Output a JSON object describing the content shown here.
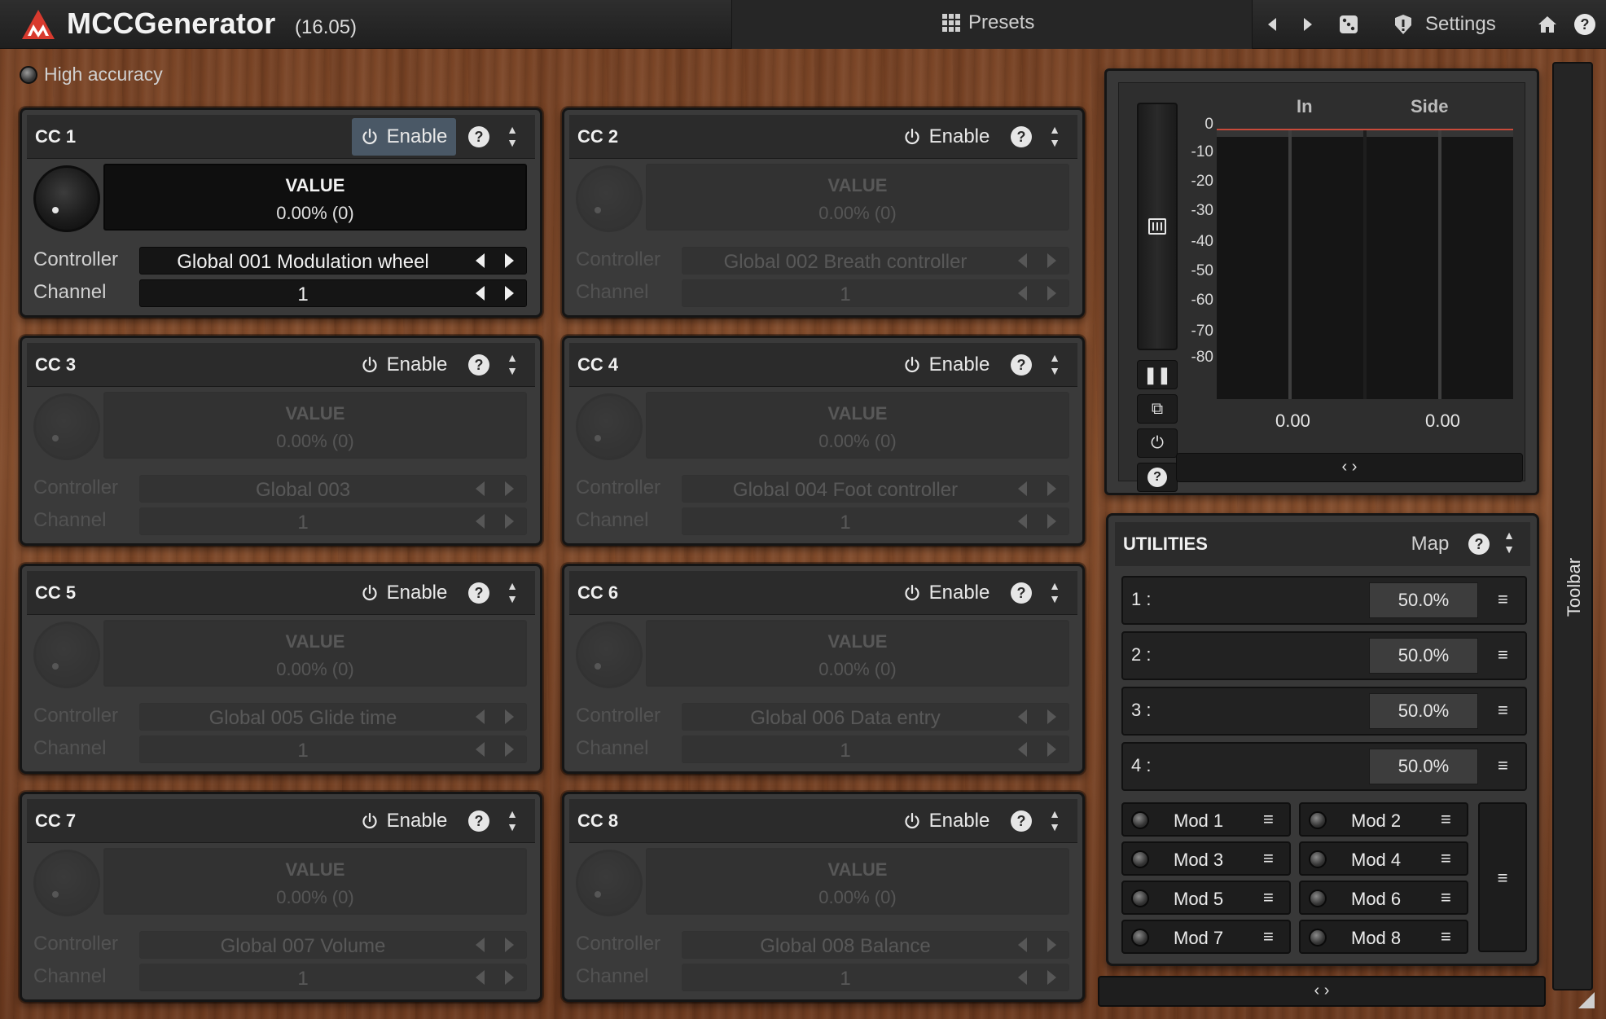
{
  "app": {
    "title": "MCCGenerator",
    "version": "(16.05)",
    "presets_label": "Presets",
    "settings_label": "Settings",
    "accent_color": "#d83a2e"
  },
  "high_accuracy": {
    "label": "High accuracy"
  },
  "cc_panels": [
    {
      "title": "CC 1",
      "enable_label": "Enable",
      "enabled": true,
      "value_label": "VALUE",
      "value": "0.00% (0)",
      "controller_label": "Controller",
      "controller": "Global 001 Modulation wheel",
      "channel_label": "Channel",
      "channel": "1"
    },
    {
      "title": "CC 2",
      "enable_label": "Enable",
      "enabled": false,
      "value_label": "VALUE",
      "value": "0.00% (0)",
      "controller_label": "Controller",
      "controller": "Global 002 Breath controller",
      "channel_label": "Channel",
      "channel": "1"
    },
    {
      "title": "CC 3",
      "enable_label": "Enable",
      "enabled": false,
      "value_label": "VALUE",
      "value": "0.00% (0)",
      "controller_label": "Controller",
      "controller": "Global 003",
      "channel_label": "Channel",
      "channel": "1"
    },
    {
      "title": "CC 4",
      "enable_label": "Enable",
      "enabled": false,
      "value_label": "VALUE",
      "value": "0.00% (0)",
      "controller_label": "Controller",
      "controller": "Global 004 Foot controller",
      "channel_label": "Channel",
      "channel": "1"
    },
    {
      "title": "CC 5",
      "enable_label": "Enable",
      "enabled": false,
      "value_label": "VALUE",
      "value": "0.00% (0)",
      "controller_label": "Controller",
      "controller": "Global 005 Glide time",
      "channel_label": "Channel",
      "channel": "1"
    },
    {
      "title": "CC 6",
      "enable_label": "Enable",
      "enabled": false,
      "value_label": "VALUE",
      "value": "0.00% (0)",
      "controller_label": "Controller",
      "controller": "Global 006 Data entry",
      "channel_label": "Channel",
      "channel": "1"
    },
    {
      "title": "CC 7",
      "enable_label": "Enable",
      "enabled": false,
      "value_label": "VALUE",
      "value": "0.00% (0)",
      "controller_label": "Controller",
      "controller": "Global 007 Volume",
      "channel_label": "Channel",
      "channel": "1"
    },
    {
      "title": "CC 8",
      "enable_label": "Enable",
      "enabled": false,
      "value_label": "VALUE",
      "value": "0.00% (0)",
      "controller_label": "Controller",
      "controller": "Global 008 Balance",
      "channel_label": "Channel",
      "channel": "1"
    }
  ],
  "meter": {
    "columns": [
      "In",
      "Side"
    ],
    "scale": [
      "0",
      "-10",
      "-20",
      "-30",
      "-40",
      "-50",
      "-60",
      "-70",
      "-80"
    ],
    "peaks": [
      "0.00",
      "0.00"
    ],
    "scroll_label": "‹ ›"
  },
  "utilities": {
    "title": "UTILITIES",
    "map_label": "Map",
    "sliders": [
      {
        "label": "1 :",
        "value": "50.0%"
      },
      {
        "label": "2 :",
        "value": "50.0%"
      },
      {
        "label": "3 :",
        "value": "50.0%"
      },
      {
        "label": "4 :",
        "value": "50.0%"
      }
    ],
    "mods": [
      "Mod 1",
      "Mod 2",
      "Mod 3",
      "Mod 4",
      "Mod 5",
      "Mod 6",
      "Mod 7",
      "Mod 8"
    ],
    "menu_glyph": "≡"
  },
  "bottom_scroll_label": "‹ ›",
  "toolbar_label": "Toolbar"
}
